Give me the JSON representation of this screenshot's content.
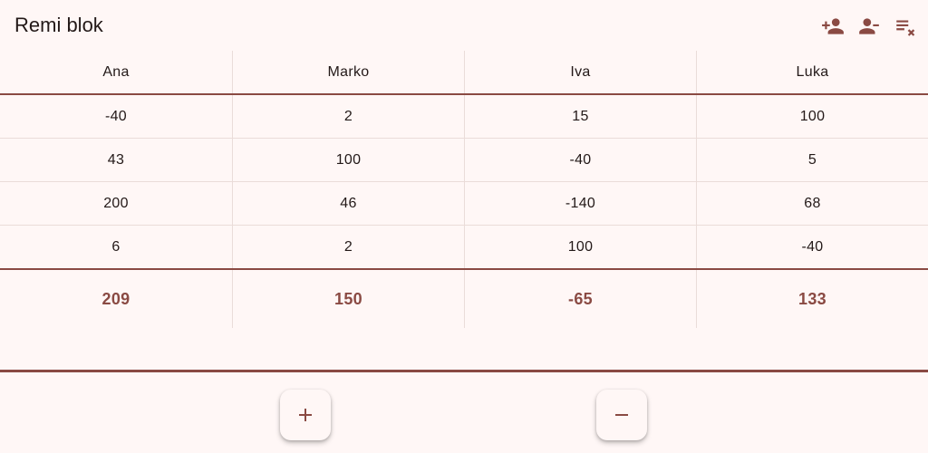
{
  "app": {
    "title": "Remi blok"
  },
  "toolbar": {
    "add_player_icon": "person-add-icon",
    "remove_player_icon": "person-remove-icon",
    "clear_all_icon": "clear-all-icon"
  },
  "players": [
    "Ana",
    "Marko",
    "Iva",
    "Luka"
  ],
  "rounds": [
    [
      "-40",
      "2",
      "15",
      "100"
    ],
    [
      "43",
      "100",
      "-40",
      "5"
    ],
    [
      "200",
      "46",
      "-140",
      "68"
    ],
    [
      "6",
      "2",
      "100",
      "-40"
    ]
  ],
  "totals": [
    "209",
    "150",
    "-65",
    "133"
  ],
  "bottom": {
    "add_round_icon": "plus-icon",
    "remove_round_icon": "minus-icon"
  },
  "colors": {
    "accent": "#8a4a43",
    "background": "#fff7f6",
    "divider": "#eadcd9"
  }
}
